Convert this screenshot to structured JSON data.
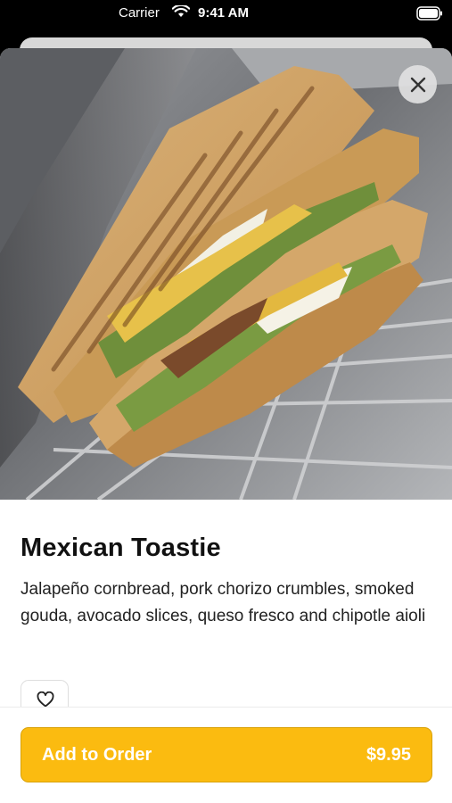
{
  "status_bar": {
    "carrier": "Carrier",
    "time": "9:41 AM"
  },
  "item": {
    "title": "Mexican Toastie",
    "description": "Jalapeño cornbread, pork chorizo crumbles, smoked gouda, avocado slices, queso fresco and chipotle aioli",
    "image_icon": "sandwich-photo"
  },
  "actions": {
    "close_icon": "close-icon",
    "favorite_icon": "heart-outline-icon",
    "add_to_order_label": "Add to Order",
    "price": "$9.95"
  },
  "colors": {
    "accent": "#fbbb10",
    "accent_border": "#d9a20a",
    "text": "#111111"
  }
}
